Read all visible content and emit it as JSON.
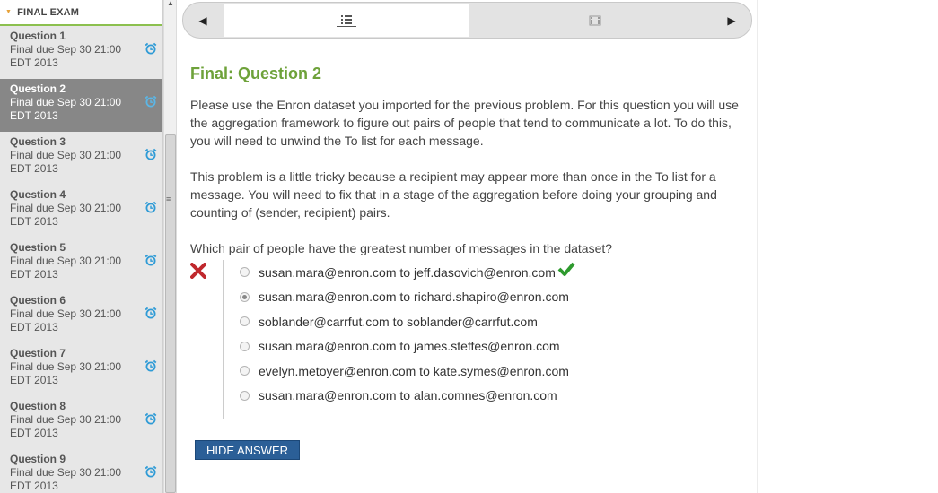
{
  "sidebar": {
    "section_title": "FINAL EXAM",
    "items": [
      {
        "title": "Question 1",
        "due": "Final due Sep 30 21:00",
        "tz": "EDT 2013",
        "active": false
      },
      {
        "title": "Question 2",
        "due": "Final due Sep 30 21:00",
        "tz": "EDT 2013",
        "active": true
      },
      {
        "title": "Question 3",
        "due": "Final due Sep 30 21:00",
        "tz": "EDT 2013",
        "active": false
      },
      {
        "title": "Question 4",
        "due": "Final due Sep 30 21:00",
        "tz": "EDT 2013",
        "active": false
      },
      {
        "title": "Question 5",
        "due": "Final due Sep 30 21:00",
        "tz": "EDT 2013",
        "active": false
      },
      {
        "title": "Question 6",
        "due": "Final due Sep 30 21:00",
        "tz": "EDT 2013",
        "active": false
      },
      {
        "title": "Question 7",
        "due": "Final due Sep 30 21:00",
        "tz": "EDT 2013",
        "active": false
      },
      {
        "title": "Question 8",
        "due": "Final due Sep 30 21:00",
        "tz": "EDT 2013",
        "active": false
      },
      {
        "title": "Question 9",
        "due": "Final due Sep 30 21:00",
        "tz": "EDT 2013",
        "active": false
      }
    ],
    "icon": "alarm-clock-icon"
  },
  "nav": {
    "prev_icon": "triangle-left-icon",
    "next_icon": "triangle-right-icon",
    "tabs": [
      {
        "icon": "problem-list-icon",
        "selected": true
      },
      {
        "icon": "video-film-icon",
        "selected": false
      }
    ]
  },
  "problem": {
    "title": "Final: Question 2",
    "paragraph1": "Please use the Enron dataset you imported for the previous problem. For this question you will use the aggregation framework to figure out pairs of people that tend to communicate a lot. To do this, you will need to unwind the To list for each message.",
    "paragraph2": "This problem is a little tricky because a recipient may appear more than once in the To list for a message. You will need to fix that in a stage of the aggregation before doing your grouping and counting of (sender, recipient) pairs.",
    "prompt": "Which pair of people have the greatest number of messages in the dataset?",
    "result_icon": "incorrect-x-icon",
    "choices": [
      {
        "label": "susan.mara@enron.com to jeff.dasovich@enron.com",
        "selected": false,
        "correct": true
      },
      {
        "label": "susan.mara@enron.com to richard.shapiro@enron.com",
        "selected": true,
        "correct": false
      },
      {
        "label": "soblander@carrfut.com to soblander@carrfut.com",
        "selected": false,
        "correct": false
      },
      {
        "label": "susan.mara@enron.com to james.steffes@enron.com",
        "selected": false,
        "correct": false
      },
      {
        "label": "evelyn.metoyer@enron.com to kate.symes@enron.com",
        "selected": false,
        "correct": false
      },
      {
        "label": "susan.mara@enron.com to alan.comnes@enron.com",
        "selected": false,
        "correct": false
      }
    ],
    "hide_answer_label": "HIDE ANSWER"
  },
  "colors": {
    "accent_green": "#6ea23a",
    "correct_green": "#2e9a2e",
    "wrong_red": "#c0282d",
    "button_blue": "#2b5f97",
    "active_item": "#878787"
  }
}
